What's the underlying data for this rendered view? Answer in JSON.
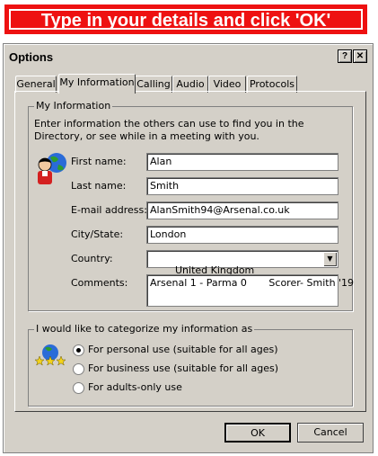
{
  "banner": {
    "text": "Type in your details and click 'OK'"
  },
  "window": {
    "title": "Options",
    "help_btn": "?",
    "close_btn": "✕"
  },
  "tabs": [
    "General",
    "My Information",
    "Calling",
    "Audio",
    "Video",
    "Protocols"
  ],
  "active_tab": "My Information",
  "my_info": {
    "group_label": "My Information",
    "description": "Enter information the others can use to find you in the Directory, or see while in a meeting with you.",
    "fields": {
      "first_name": {
        "label": "First name:",
        "value": "Alan"
      },
      "last_name": {
        "label": "Last name:",
        "value": "Smith"
      },
      "email": {
        "label": "E-mail address:",
        "value": "AlanSmith94@Arsenal.co.uk"
      },
      "city": {
        "label": "City/State:",
        "value": "London"
      },
      "country": {
        "label": "Country:",
        "value": "United Kingdom"
      },
      "comments": {
        "label": "Comments:",
        "value": "Arsenal 1 - Parma 0       Scorer- Smith '19"
      }
    }
  },
  "categorize": {
    "group_label": "I would like to categorize my information as",
    "options": [
      {
        "label": "For personal use (suitable for all ages)",
        "selected": true
      },
      {
        "label": "For business use (suitable for all ages)",
        "selected": false
      },
      {
        "label": "For adults-only use",
        "selected": false
      }
    ]
  },
  "buttons": {
    "ok": "OK",
    "cancel": "Cancel"
  },
  "icons": [
    "person-globe-icon",
    "globe-stars-icon",
    "dropdown-arrow-icon"
  ]
}
